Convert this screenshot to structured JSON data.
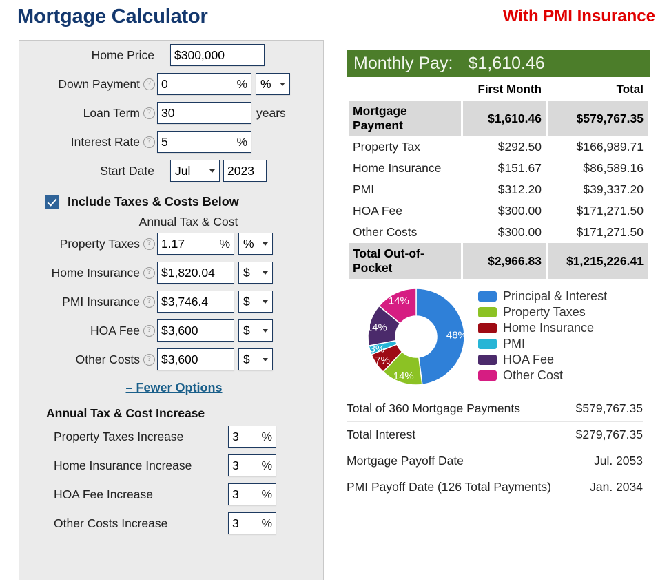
{
  "header": {
    "title": "Mortgage Calculator",
    "pmi_banner": "With PMI Insurance",
    "title_color": "#14386e",
    "banner_color": "#e00000"
  },
  "form": {
    "home_price": {
      "label": "Home Price",
      "value": "$300,000"
    },
    "down_payment": {
      "label": "Down Payment",
      "value": "0",
      "suffix": "%",
      "unit": "%"
    },
    "loan_term": {
      "label": "Loan Term",
      "value": "30",
      "unit_after": "years"
    },
    "interest_rate": {
      "label": "Interest Rate",
      "value": "5",
      "suffix": "%"
    },
    "start_date": {
      "label": "Start Date",
      "month": "Jul",
      "year": "2023"
    },
    "include_checkbox": {
      "label": "Include Taxes & Costs Below",
      "checked": true
    },
    "annual_heading": "Annual Tax & Cost",
    "costs": [
      {
        "label": "Property Taxes",
        "value": "1.17",
        "suffix": "%",
        "unit": "%"
      },
      {
        "label": "Home Insurance",
        "value": "$1,820.04",
        "suffix": "",
        "unit": "$"
      },
      {
        "label": "PMI Insurance",
        "value": "$3,746.4",
        "suffix": "",
        "unit": "$"
      },
      {
        "label": "HOA Fee",
        "value": "$3,600",
        "suffix": "",
        "unit": "$"
      },
      {
        "label": "Other Costs",
        "value": "$3,600",
        "suffix": "",
        "unit": "$"
      }
    ],
    "fewer_options": "– Fewer Options",
    "increase_title": "Annual Tax & Cost Increase",
    "increases": [
      {
        "label": "Property Taxes Increase",
        "value": "3",
        "suffix": "%"
      },
      {
        "label": "Home Insurance Increase",
        "value": "3",
        "suffix": "%"
      },
      {
        "label": "HOA Fee Increase",
        "value": "3",
        "suffix": "%"
      },
      {
        "label": "Other Costs Increase",
        "value": "3",
        "suffix": "%"
      }
    ]
  },
  "results": {
    "monthly_pay_label": "Monthly Pay:",
    "monthly_pay_value": "$1,610.46",
    "monthly_bar_color": "#4c7d2a",
    "columns": [
      "First Month",
      "Total"
    ],
    "rows": [
      {
        "label": "Mortgage Payment",
        "first_month": "$1,610.46",
        "total": "$579,767.35",
        "highlight": true
      },
      {
        "label": "Property Tax",
        "first_month": "$292.50",
        "total": "$166,989.71",
        "highlight": false
      },
      {
        "label": "Home Insurance",
        "first_month": "$151.67",
        "total": "$86,589.16",
        "highlight": false
      },
      {
        "label": "PMI",
        "first_month": "$312.20",
        "total": "$39,337.20",
        "highlight": false
      },
      {
        "label": "HOA Fee",
        "first_month": "$300.00",
        "total": "$171,271.50",
        "highlight": false
      },
      {
        "label": "Other Costs",
        "first_month": "$300.00",
        "total": "$171,271.50",
        "highlight": false
      },
      {
        "label": "Total Out-of-Pocket",
        "first_month": "$2,966.83",
        "total": "$1,215,226.41",
        "highlight": true
      }
    ],
    "summary": [
      {
        "label": "Total of 360 Mortgage Payments",
        "value": "$579,767.35"
      },
      {
        "label": "Total Interest",
        "value": "$279,767.35"
      },
      {
        "label": "Mortgage Payoff Date",
        "value": "Jul. 2053"
      },
      {
        "label": "PMI Payoff Date (126 Total Payments)",
        "value": "Jan. 2034"
      }
    ]
  },
  "chart_data": {
    "type": "pie",
    "title": "",
    "donut": true,
    "categories": [
      "Principal & Interest",
      "Property Taxes",
      "Home Insurance",
      "PMI",
      "HOA Fee",
      "Other Cost"
    ],
    "values": [
      48,
      14,
      7,
      3,
      14,
      14
    ],
    "labels": [
      "48%",
      "14%",
      "7%",
      "3%",
      "14%",
      "14%"
    ],
    "colors": [
      "#2f80d8",
      "#8cc224",
      "#9e0b14",
      "#27b5d6",
      "#4b2a6b",
      "#d61d82"
    ],
    "legend_position": "right",
    "start_angle_deg": 0,
    "direction": "clockwise"
  }
}
